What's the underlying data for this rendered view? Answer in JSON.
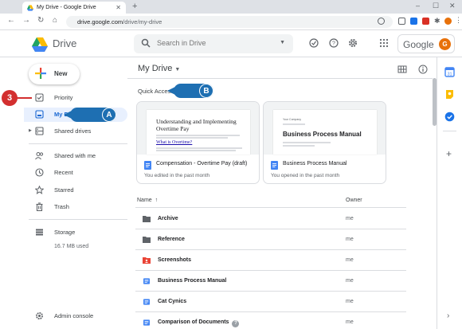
{
  "browser": {
    "tab_title": "My Drive - Google Drive",
    "new_tab": "+",
    "url_host": "drive.google.com",
    "url_path": "/drive/my-drive"
  },
  "header": {
    "app_name": "Drive",
    "search_placeholder": "Search in Drive",
    "google_word": "Google",
    "avatar_letter": "G"
  },
  "sidebar": {
    "new_label": "New",
    "items": [
      {
        "label": "Priority",
        "icon": "check-box-icon"
      },
      {
        "label": "My Drive",
        "icon": "drive-icon"
      },
      {
        "label": "Shared drives",
        "icon": "shared-drives-icon"
      },
      {
        "label": "Shared with me",
        "icon": "people-icon"
      },
      {
        "label": "Recent",
        "icon": "clock-icon"
      },
      {
        "label": "Starred",
        "icon": "star-icon"
      },
      {
        "label": "Trash",
        "icon": "trash-icon"
      },
      {
        "label": "Storage",
        "icon": "storage-icon"
      }
    ],
    "storage_used": "16.7 MB used",
    "admin_console": "Admin console"
  },
  "main": {
    "title": "My Drive",
    "quick_access_label": "Quick Access",
    "cards": [
      {
        "title": "Compensation - Overtime Pay (draft)",
        "subtitle": "You edited in the past month",
        "preview_title": "Understanding and Implementing Overtime Pay",
        "preview_link": "What is Overtime?"
      },
      {
        "title": "Business Process Manual",
        "subtitle": "You opened in the past month",
        "preview_company": "Your Company",
        "preview_title": "Business Process Manual"
      }
    ],
    "columns": {
      "name": "Name",
      "sort_arrow": "↑",
      "owner": "Owner"
    },
    "rows": [
      {
        "name": "Archive",
        "type": "folder",
        "owner": "me"
      },
      {
        "name": "Reference",
        "type": "folder",
        "owner": "me"
      },
      {
        "name": "Screenshots",
        "type": "shared-folder",
        "owner": "me"
      },
      {
        "name": "Business Process Manual",
        "type": "doc",
        "owner": "me"
      },
      {
        "name": "Cat Cynics",
        "type": "doc",
        "owner": "me"
      },
      {
        "name": "Comparison of Documents",
        "type": "doc",
        "owner": "me",
        "badge": "?"
      }
    ]
  },
  "callouts": {
    "a": "A",
    "b": "B",
    "step": "3"
  },
  "colors": {
    "accent": "#1967d2",
    "active_bg": "#e8f0fe",
    "callout_blue": "#1e6fb2",
    "step_red": "#d32f2f"
  }
}
